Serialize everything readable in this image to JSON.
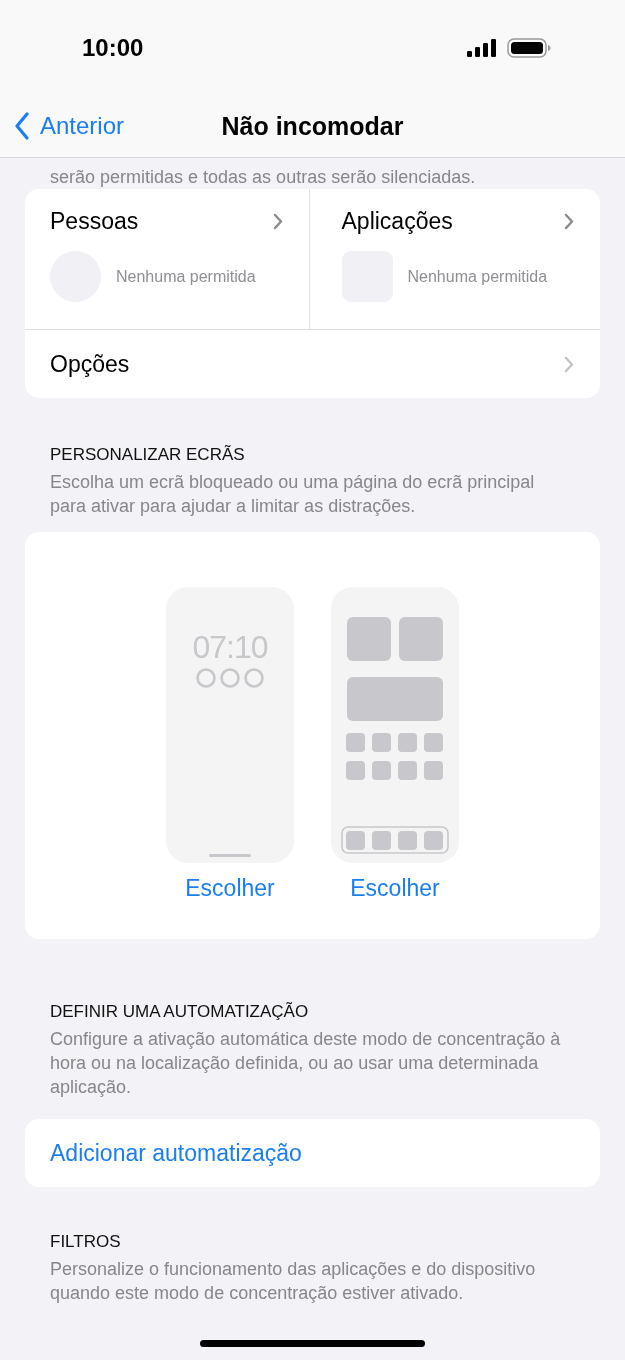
{
  "status_bar": {
    "time": "10:00"
  },
  "nav": {
    "back": "Anterior",
    "title": "Não incomodar"
  },
  "intro_tail": "serão permitidas e todas as outras serão silenciadas.",
  "allowed": {
    "columns": [
      {
        "title": "Pessoas",
        "kind": "people",
        "note": "Nenhuma permitida"
      },
      {
        "title": "Aplicações",
        "kind": "apps",
        "note": "Nenhuma permitida"
      }
    ],
    "options": "Opções"
  },
  "screens_section": {
    "header": "PERSONALIZAR ECRÃS",
    "description": "Escolha um ecrã bloqueado ou uma página do ecrã principal para ativar para ajudar a limitar as distrações.",
    "previews": [
      {
        "kind": "lock",
        "time": "07:10",
        "button": "Escolher"
      },
      {
        "kind": "home",
        "button": "Escolher"
      }
    ]
  },
  "automation_section": {
    "header": "DEFINIR UMA AUTOMATIZAÇÃO",
    "description": "Configure a ativação automática deste modo de concentração à hora ou na localização definida, ou ao usar uma determinada aplicação.",
    "button": "Adicionar automatização"
  },
  "filters_section": {
    "header": "FILTROS",
    "description": "Personalize o funcionamento das aplicações e do dispositivo quando este modo de concentração estiver ativado."
  }
}
